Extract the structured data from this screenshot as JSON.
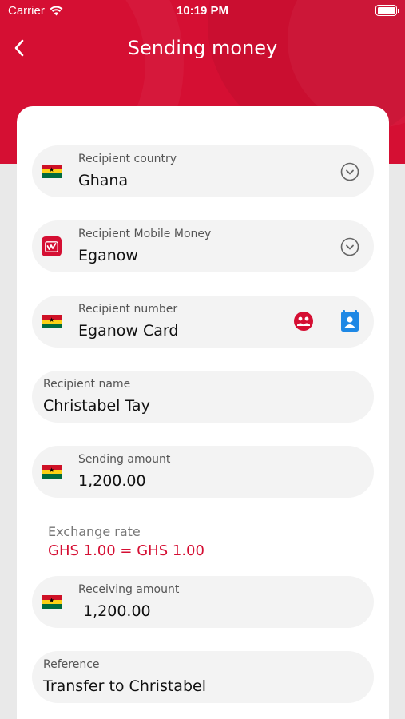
{
  "status_bar": {
    "carrier": "Carrier",
    "time": "10:19 PM"
  },
  "header": {
    "title": "Sending money"
  },
  "form": {
    "recipient_country": {
      "label": "Recipient country",
      "value": "Ghana",
      "flag_icon": "ghana-flag-icon"
    },
    "recipient_mobile_money": {
      "label": "Recipient Mobile Money",
      "value": "Eganow",
      "icon": "eganow-logo-icon"
    },
    "recipient_number": {
      "label": "Recipient number",
      "value": "Eganow Card",
      "flag_icon": "ghana-flag-icon"
    },
    "recipient_name": {
      "label": "Recipient name",
      "value": "Christabel Tay"
    },
    "sending_amount": {
      "label": "Sending amount",
      "value": "1,200.00",
      "flag_icon": "ghana-flag-icon"
    },
    "exchange_rate": {
      "label": "Exchange rate",
      "value": "GHS 1.00 = GHS 1.00"
    },
    "receiving_amount": {
      "label": "Receiving amount",
      "value": " 1,200.00",
      "flag_icon": "ghana-flag-icon"
    },
    "reference": {
      "label": "Reference",
      "value": "Transfer to Christabel"
    }
  },
  "colors": {
    "brand": "#d50f33",
    "contacts_icon": "#1e88e5",
    "field_bg": "#f3f3f3"
  }
}
